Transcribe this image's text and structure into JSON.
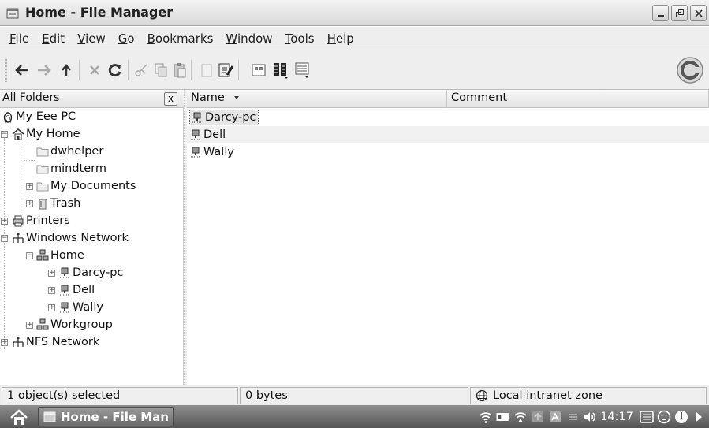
{
  "window": {
    "title": "Home - File Manager"
  },
  "menu": [
    "File",
    "Edit",
    "View",
    "Go",
    "Bookmarks",
    "Window",
    "Tools",
    "Help"
  ],
  "menu_mnemonics": [
    "F",
    "E",
    "V",
    "G",
    "B",
    "W",
    "T",
    "H"
  ],
  "toolbar": {
    "buttons": [
      "back-icon",
      "forward-icon",
      "up-icon",
      "stop-icon",
      "reload-icon",
      "cut-icon",
      "copy-icon",
      "paste-icon",
      "delete-icon",
      "properties-icon",
      "icon-view-icon",
      "detail-view-icon",
      "list-view-icon"
    ]
  },
  "tree_pane": {
    "header": "All Folders",
    "close_label": "x",
    "items": [
      {
        "label": "My Eee PC",
        "icon": "linux-penguin-icon"
      },
      {
        "label": "My Home",
        "icon": "home-icon"
      },
      {
        "label": "dwhelper",
        "icon": "folder-icon"
      },
      {
        "label": "mindterm",
        "icon": "folder-icon"
      },
      {
        "label": "My Documents",
        "icon": "folder-icon"
      },
      {
        "label": "Trash",
        "icon": "trash-icon"
      },
      {
        "label": "Printers",
        "icon": "printer-icon"
      },
      {
        "label": "Windows Network",
        "icon": "network-icon"
      },
      {
        "label": "Home",
        "icon": "workgroup-icon"
      },
      {
        "label": "Darcy-pc",
        "icon": "computer-icon"
      },
      {
        "label": "Dell",
        "icon": "computer-icon"
      },
      {
        "label": "Wally",
        "icon": "computer-icon"
      },
      {
        "label": "Workgroup",
        "icon": "workgroup-icon"
      },
      {
        "label": "NFS Network",
        "icon": "network-icon"
      }
    ]
  },
  "file_list": {
    "columns": [
      "Name",
      "Comment"
    ],
    "sort_indicator": "descending",
    "rows": [
      {
        "name": "Darcy-pc",
        "comment": "",
        "selected": true
      },
      {
        "name": "Dell",
        "comment": "",
        "selected": false
      },
      {
        "name": "Wally",
        "comment": "",
        "selected": false
      }
    ]
  },
  "status": {
    "selection": "1 object(s) selected",
    "size": "0 bytes",
    "zone": "Local intranet zone"
  },
  "taskbar": {
    "task_label": "Home - File Man",
    "clock": "14:17"
  },
  "colors": {
    "selection_bg": "#e6e6e6",
    "taskbar_top": "#8f8f8f",
    "taskbar_bottom": "#555555"
  }
}
